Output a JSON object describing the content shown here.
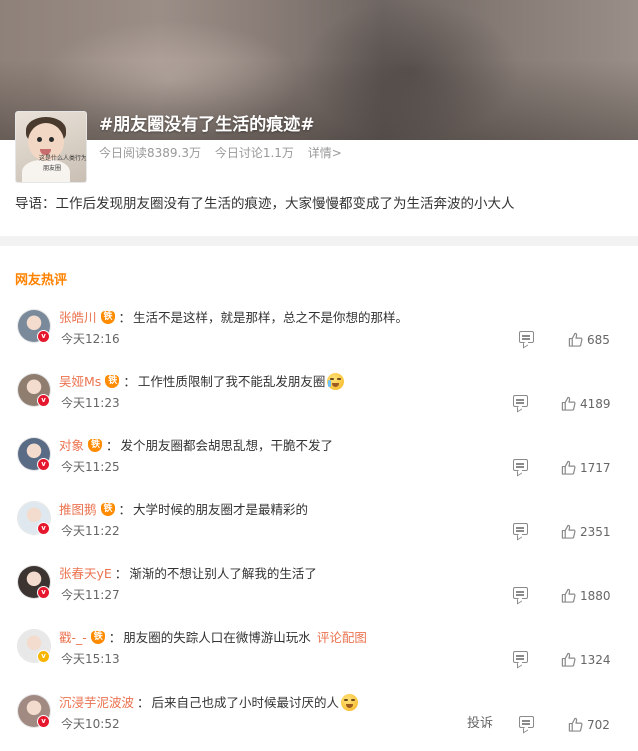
{
  "topic": {
    "title": "#朋友圈没有了生活的痕迹#",
    "thumb_caption_1": "这是什么人类行为",
    "thumb_caption_2": "朋友圈",
    "reads": "今日阅读8389.3万",
    "discussions": "今日讨论1.1万",
    "details": "详情>",
    "intro": "导语：工作后发现朋友圈没有了生活的痕迹，大家慢慢都变成了为生活奔波的小大人"
  },
  "section_title": "网友热评",
  "medal_text": "铁",
  "comments": [
    {
      "user": "张皓川",
      "has_medal": true,
      "text": "生活不是这样，就是那样，总之不是你想的那样。",
      "time": "今天12:16",
      "likes": "685",
      "badge": "red",
      "avatar_color": "#7a8a9a"
    },
    {
      "user": "吴娅Ms",
      "has_medal": true,
      "text": "工作性质限制了我不能乱发朋友圈",
      "emoji": "tear",
      "time": "今天11:23",
      "likes": "4189",
      "badge": "red",
      "avatar_color": "#8f7d70"
    },
    {
      "user": "对象",
      "has_medal": true,
      "text": "发个朋友圈都会胡思乱想，干脆不发了",
      "time": "今天11:25",
      "likes": "1717",
      "badge": "red",
      "avatar_color": "#5a6b85"
    },
    {
      "user": "推图鹅",
      "has_medal": true,
      "text": "大学时候的朋友圈才是最精彩的",
      "time": "今天11:22",
      "likes": "2351",
      "badge": "red",
      "avatar_color": "#dfe8ee"
    },
    {
      "user": "张春天yE",
      "has_medal": false,
      "text": "渐渐的不想让别人了解我的生活了",
      "time": "今天11:27",
      "likes": "1880",
      "badge": "red",
      "avatar_color": "#3b3431"
    },
    {
      "user": "戳-_-",
      "has_medal": true,
      "text": "朋友圈的失踪人口在微博游山玩水",
      "link": "评论配图",
      "time": "今天15:13",
      "likes": "1324",
      "badge": "yellow",
      "avatar_color": "#e8e8e8"
    },
    {
      "user": "沉浸芋泥波波",
      "has_medal": false,
      "text": "后来自己也成了小时候最讨厌的人",
      "emoji": "sweat",
      "time": "今天10:52",
      "likes": "702",
      "report": "投诉",
      "badge": "red",
      "avatar_color": "#a08a82"
    }
  ],
  "icons": {
    "comment": "comment-icon",
    "like": "thumbs-up-icon",
    "verified": "verified-badge-icon"
  },
  "colors": {
    "username": "#eb7350",
    "section_title": "#ff8200",
    "verified_red": "#e6162d",
    "verified_yellow": "#f7b500"
  }
}
